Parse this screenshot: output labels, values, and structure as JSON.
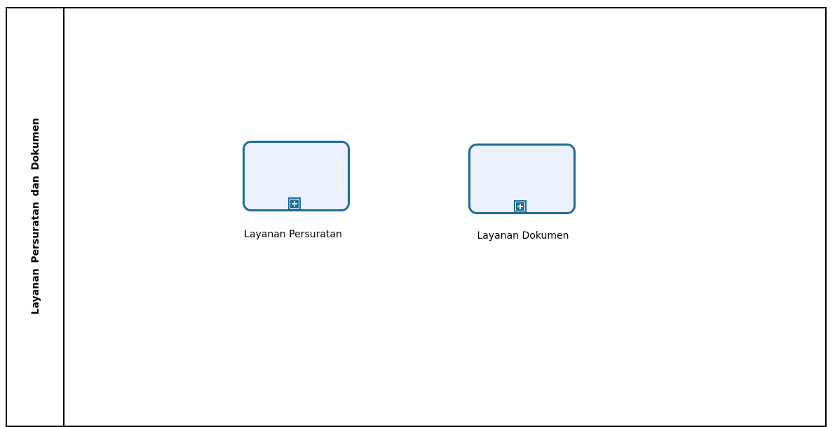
{
  "pool": {
    "lane_title": "Layanan  Persuratan  dan  Dokumen"
  },
  "subprocesses": [
    {
      "label": "Layanan Persuratan",
      "marker": "plus-icon"
    },
    {
      "label": "Layanan Dokumen",
      "marker": "plus-icon"
    }
  ],
  "colors": {
    "task_border": "#1c6c9a",
    "task_fill": "#edf0fd",
    "lane_border": "#000000"
  }
}
